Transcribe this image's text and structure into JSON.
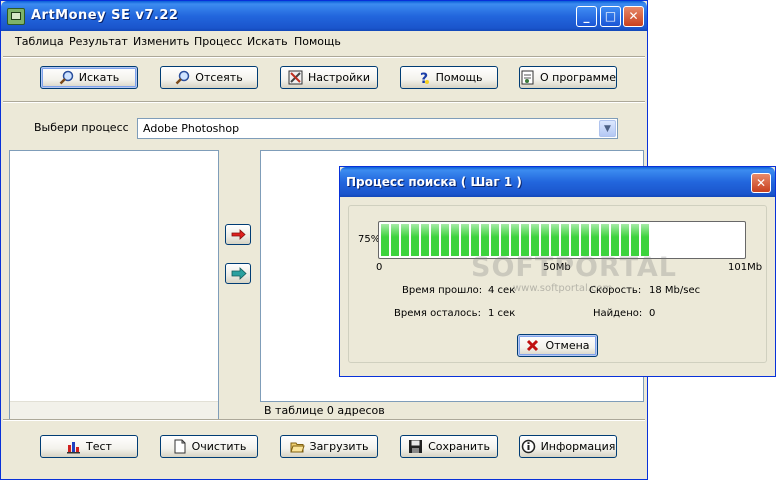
{
  "window": {
    "title": "ArtMoney SE v7.22"
  },
  "menu": [
    "Таблица",
    "Результат",
    "Изменить",
    "Процесс",
    "Искать",
    "Помощь"
  ],
  "toolbar": {
    "search": "Искать",
    "filter": "Отсеять",
    "settings": "Настройки",
    "help": "Помощь",
    "about": "О программе"
  },
  "process": {
    "label": "Выбери процесс",
    "selected": "Adobe Photoshop"
  },
  "status": "В таблице 0 адресов",
  "bottom": {
    "test": "Тест",
    "clear": "Очистить",
    "load": "Загрузить",
    "save": "Сохранить",
    "info": "Информация"
  },
  "dialog": {
    "title": "Процесс поиска ( Шаг 1 )",
    "progress_label": "75%",
    "progress": 0.75,
    "scale_min": "0",
    "scale_mid": "50Mb",
    "scale_max": "101Mb",
    "elapsed_label": "Время прошло:",
    "elapsed_value": "4 сек",
    "remaining_label": "Время осталось:",
    "remaining_value": "1 сек",
    "speed_label": "Скорость:",
    "speed_value": "18 Mb/sec",
    "found_label": "Найдено:",
    "found_value": "0",
    "cancel": "Отмена"
  },
  "watermark": {
    "main": "SOFTPORTAL",
    "sub": "www.softportal.com"
  }
}
